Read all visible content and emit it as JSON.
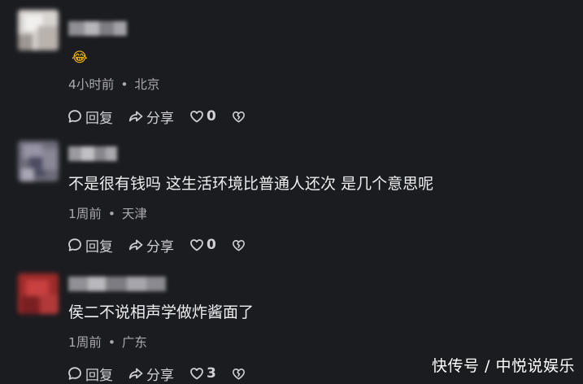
{
  "comments": [
    {
      "emoji": "😂",
      "text": "",
      "time": "4小时前",
      "location": "北京",
      "reply_label": "回复",
      "share_label": "分享",
      "likes": "0"
    },
    {
      "text": "不是很有钱吗  这生活环境比普通人还次 是几个意思呢",
      "time": "1周前",
      "location": "天津",
      "reply_label": "回复",
      "share_label": "分享",
      "likes": "0"
    },
    {
      "text": "侯二不说相声学做炸酱面了",
      "time": "1周前",
      "location": "广东",
      "reply_label": "回复",
      "share_label": "分享",
      "likes": "3"
    }
  ],
  "meta_separator": "•",
  "watermark": "快传号 / 中悦说娱乐",
  "colors": {
    "background": "#1b1c20",
    "text": "#eeeef0",
    "meta": "#a9a9ae",
    "icon": "#cfcfd4"
  }
}
